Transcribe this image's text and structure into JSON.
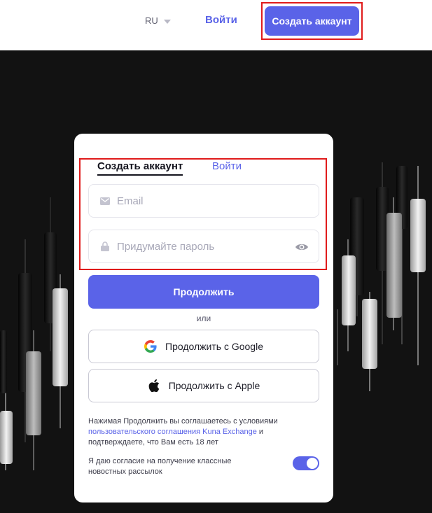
{
  "header": {
    "language": "RU",
    "login_label": "Войти",
    "create_account_label": "Создать аккаунт"
  },
  "form": {
    "tabs": [
      {
        "label": "Создать аккаунт",
        "active": true
      },
      {
        "label": "Войти",
        "active": false
      }
    ],
    "email_placeholder": "Email",
    "password_placeholder": "Придумайте пароль",
    "continue_label": "Продолжить",
    "or_label": "или",
    "google_label": "Продолжить с Google",
    "apple_label": "Продолжить с Apple",
    "terms_prefix": "Нажимая Продолжить вы соглашаетесь с условиями",
    "terms_link": "пользовательского соглашения Kuna Exchange",
    "terms_suffix": "и подтверждаете, что Вам есть 18 лет",
    "consent_text": "Я даю согласие на получение классные новостных рассылок",
    "consent_enabled": true
  },
  "colors": {
    "accent": "#5a63e8",
    "background_dark": "#121212",
    "highlight": "#e01b1b"
  },
  "icons": {
    "email_field": "envelope-icon",
    "password_field": "lock-icon",
    "password_toggle": "eye-icon",
    "google": "google-icon",
    "apple": "apple-icon"
  }
}
